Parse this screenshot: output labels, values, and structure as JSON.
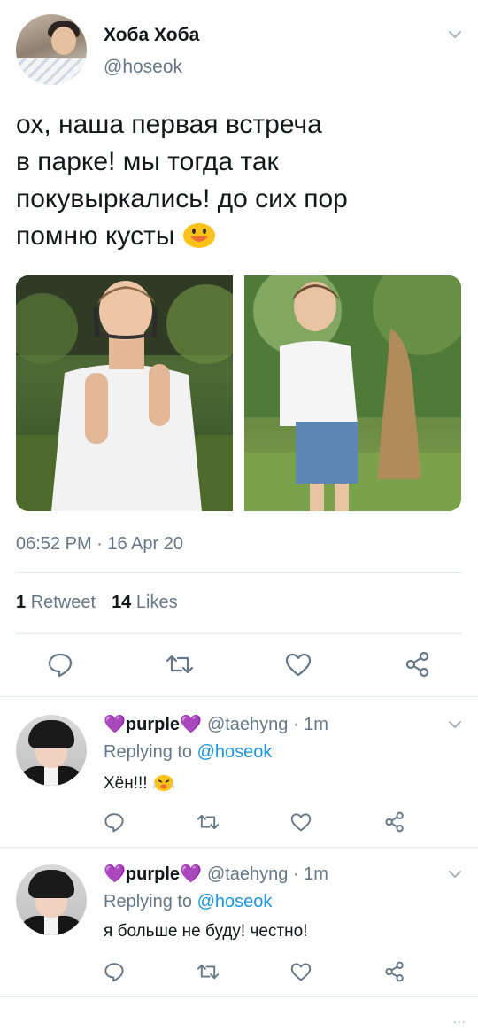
{
  "tweet": {
    "author": {
      "display_name": "Хоба Хоба",
      "handle": "@hoseok",
      "avatar": "avatar"
    },
    "menu_icon": "chevron-down-icon",
    "text_lines": [
      "ох, наша первая встреча",
      "в парке! мы тогда так",
      "покувыркались! до сих пор",
      "помню кусты"
    ],
    "text_emoji": "grinning-face-emoji",
    "photos": [
      "photo-boy-headphones",
      "photo-boy-park-tree"
    ],
    "timestamp": "06:52 PM · 16 Apr 20",
    "stats": {
      "retweets_count": "1",
      "retweets_label": "Retweet",
      "likes_count": "14",
      "likes_label": "Likes"
    },
    "actions": [
      "reply-icon",
      "retweet-icon",
      "like-icon",
      "share-icon"
    ]
  },
  "replies": [
    {
      "name_prefix_heart": "💜",
      "name": "purple",
      "name_suffix_heart": "💜",
      "handle_time": "@taehyng · 1m",
      "replying_prefix": "Replying to",
      "replying_to": "@hoseok",
      "text": "Хён!!!",
      "emoji": "face-with-steam-emoji"
    },
    {
      "name_prefix_heart": "💜",
      "name": "purple",
      "name_suffix_heart": "💜",
      "handle_time": "@taehyng · 1m",
      "replying_prefix": "Replying to",
      "replying_to": "@hoseok",
      "text": "я больше не буду! честно!",
      "emoji": ""
    }
  ],
  "footer": {
    "more": "..."
  },
  "colors": {
    "text": "#14171a",
    "secondary": "#657786",
    "link": "#1b95e0",
    "divider": "#e1e8ed",
    "heart": "#7b3fe4"
  }
}
